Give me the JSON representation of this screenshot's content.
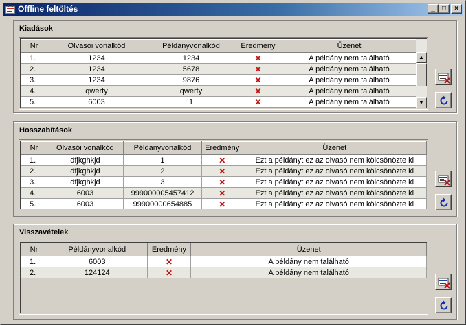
{
  "window": {
    "title": "Offline feltöltés",
    "controls": {
      "minimize": "_",
      "maximize": "□",
      "close": "×"
    }
  },
  "icons": {
    "app": "app-icon",
    "delete": "card-delete-icon",
    "refresh": "refresh-icon",
    "result_fail": "red-x-icon",
    "fail_color": "#c01010"
  },
  "kiadasok": {
    "title": "Kiadások",
    "columns": [
      "Nr",
      "Olvasói vonalkód",
      "Példányvonalkód",
      "Eredmény",
      "Üzenet"
    ],
    "rows": [
      {
        "nr": "1.",
        "olvaso": "1234",
        "peldany": "1234",
        "eredmeny": "✕",
        "uzenet": "A példány nem található"
      },
      {
        "nr": "2.",
        "olvaso": "1234",
        "peldany": "5678",
        "eredmeny": "✕",
        "uzenet": "A példány nem található"
      },
      {
        "nr": "3.",
        "olvaso": "1234",
        "peldany": "9876",
        "eredmeny": "✕",
        "uzenet": "A példány nem található"
      },
      {
        "nr": "4.",
        "olvaso": "qwerty",
        "peldany": "qwerty",
        "eredmeny": "✕",
        "uzenet": "A példány nem található"
      },
      {
        "nr": "5.",
        "olvaso": "6003",
        "peldany": "1",
        "eredmeny": "✕",
        "uzenet": "A példány nem található"
      }
    ],
    "scrollbar": {
      "up": "▲",
      "down": "▼"
    }
  },
  "hosszabitasok": {
    "title": "Hosszabítások",
    "columns": [
      "Nr",
      "Olvasói vonalkód",
      "Példányvonalkód",
      "Eredmény",
      "Üzenet"
    ],
    "rows": [
      {
        "nr": "1.",
        "olvaso": "dfjkghkjd",
        "peldany": "1",
        "eredmeny": "✕",
        "uzenet": "Ezt a példányt ez az olvasó nem kölcsönözte ki"
      },
      {
        "nr": "2.",
        "olvaso": "dfjkghkjd",
        "peldany": "2",
        "eredmeny": "✕",
        "uzenet": "Ezt a példányt ez az olvasó nem kölcsönözte ki"
      },
      {
        "nr": "3.",
        "olvaso": "dfjkghkjd",
        "peldany": "3",
        "eredmeny": "✕",
        "uzenet": "Ezt a példányt ez az olvasó nem kölcsönözte ki"
      },
      {
        "nr": "4.",
        "olvaso": "6003",
        "peldany": "999000005457412",
        "eredmeny": "✕",
        "uzenet": "Ezt a példányt ez az olvasó nem kölcsönözte ki"
      },
      {
        "nr": "5.",
        "olvaso": "6003",
        "peldany": "99900000654885",
        "eredmeny": "✕",
        "uzenet": "Ezt a példányt ez az olvasó nem kölcsönözte ki"
      }
    ]
  },
  "visszavetelek": {
    "title": "Visszavételek",
    "columns": [
      "Nr",
      "Példányvonalkód",
      "Eredmény",
      "Üzenet"
    ],
    "rows": [
      {
        "nr": "1.",
        "peldany": "6003",
        "eredmeny": "✕",
        "uzenet": "A példány nem található"
      },
      {
        "nr": "2.",
        "peldany": "124124",
        "eredmeny": "✕",
        "uzenet": "A példány nem található"
      }
    ]
  }
}
